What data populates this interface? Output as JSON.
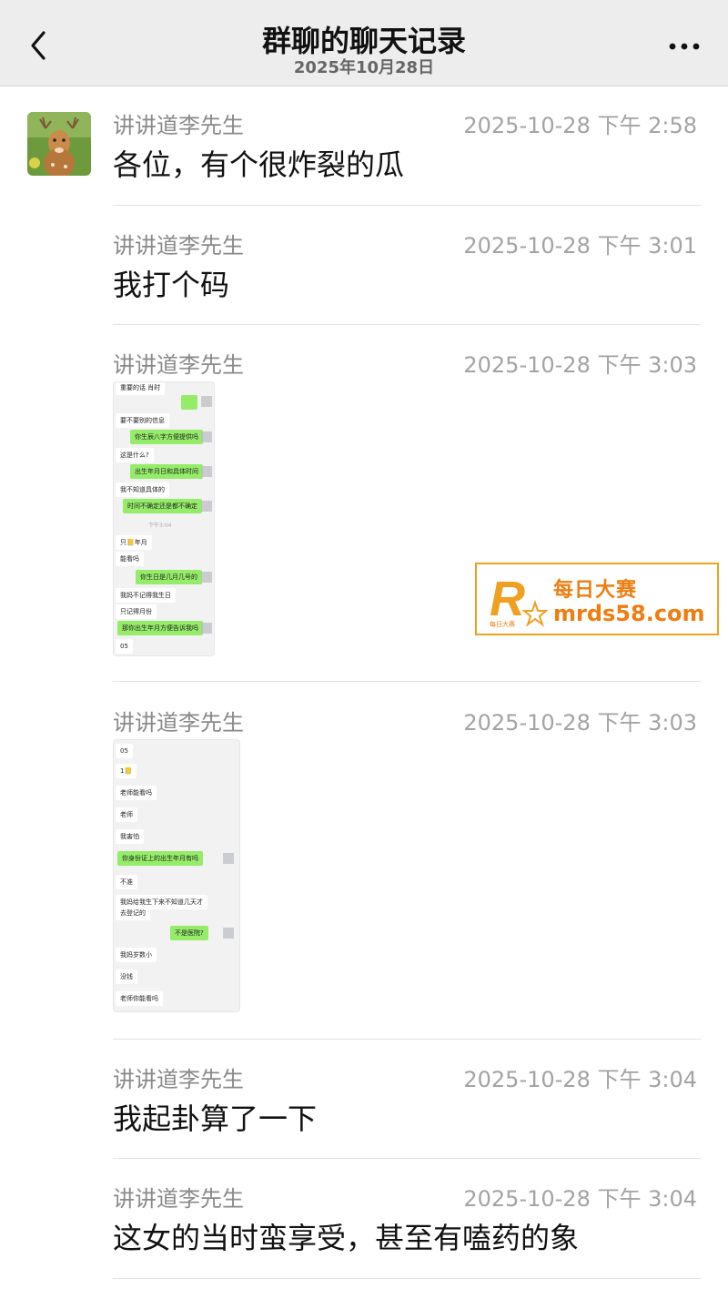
{
  "header": {
    "title": "群聊的聊天记录",
    "subtitle": "2025年10月28日"
  },
  "messages": [
    {
      "sender": "讲讲道李先生",
      "time": "2025-10-28 下午 2:58",
      "text": "各位，有个很炸裂的瓜"
    },
    {
      "sender": "讲讲道李先生",
      "time": "2025-10-28 下午 3:01",
      "text": "我打个码"
    },
    {
      "sender": "讲讲道李先生",
      "time": "2025-10-28 下午 3:03",
      "image": {
        "bubbles": [
          "你生辰八字方便提供吗",
          "这是什么?",
          "出生年月日和具体时间",
          "我不知道具体的",
          "时间不确定还是都不确定",
          "只📒年月",
          "能看吗",
          "你生日是几月几号的",
          "我妈不记得我生日",
          "只记得月份",
          "那你出生年月方便告诉我吗",
          "05"
        ],
        "top_fragment": "重要的话 肖时",
        "line2": "要不要别的信息",
        "time_sep": "下午3:04"
      }
    },
    {
      "sender": "讲讲道李先生",
      "time": "2025-10-28 下午 3:03",
      "image": {
        "bubbles": [
          "05",
          "1📒",
          "老师能看吗",
          "老师",
          "我害怕",
          "你身份证上的出生年月有吗",
          "不准",
          "我妈给我生下来不知道几天才",
          "去登记的",
          "不是医院?",
          "我妈岁数小",
          "没钱",
          "老师你能看吗"
        ]
      }
    },
    {
      "sender": "讲讲道李先生",
      "time": "2025-10-28 下午 3:04",
      "text": "我起卦算了一下"
    },
    {
      "sender": "讲讲道李先生",
      "time": "2025-10-28 下午 3:04",
      "text": "这女的当时蛮享受，甚至有嗑药的象"
    }
  ],
  "watermark": {
    "brand": "每日大赛",
    "url": "mrds58.com",
    "logo_small": "每日大赛"
  },
  "colors": {
    "header_bg": "#ededed",
    "sent_bubble": "#95ec69",
    "watermark": "#ef7d10"
  }
}
